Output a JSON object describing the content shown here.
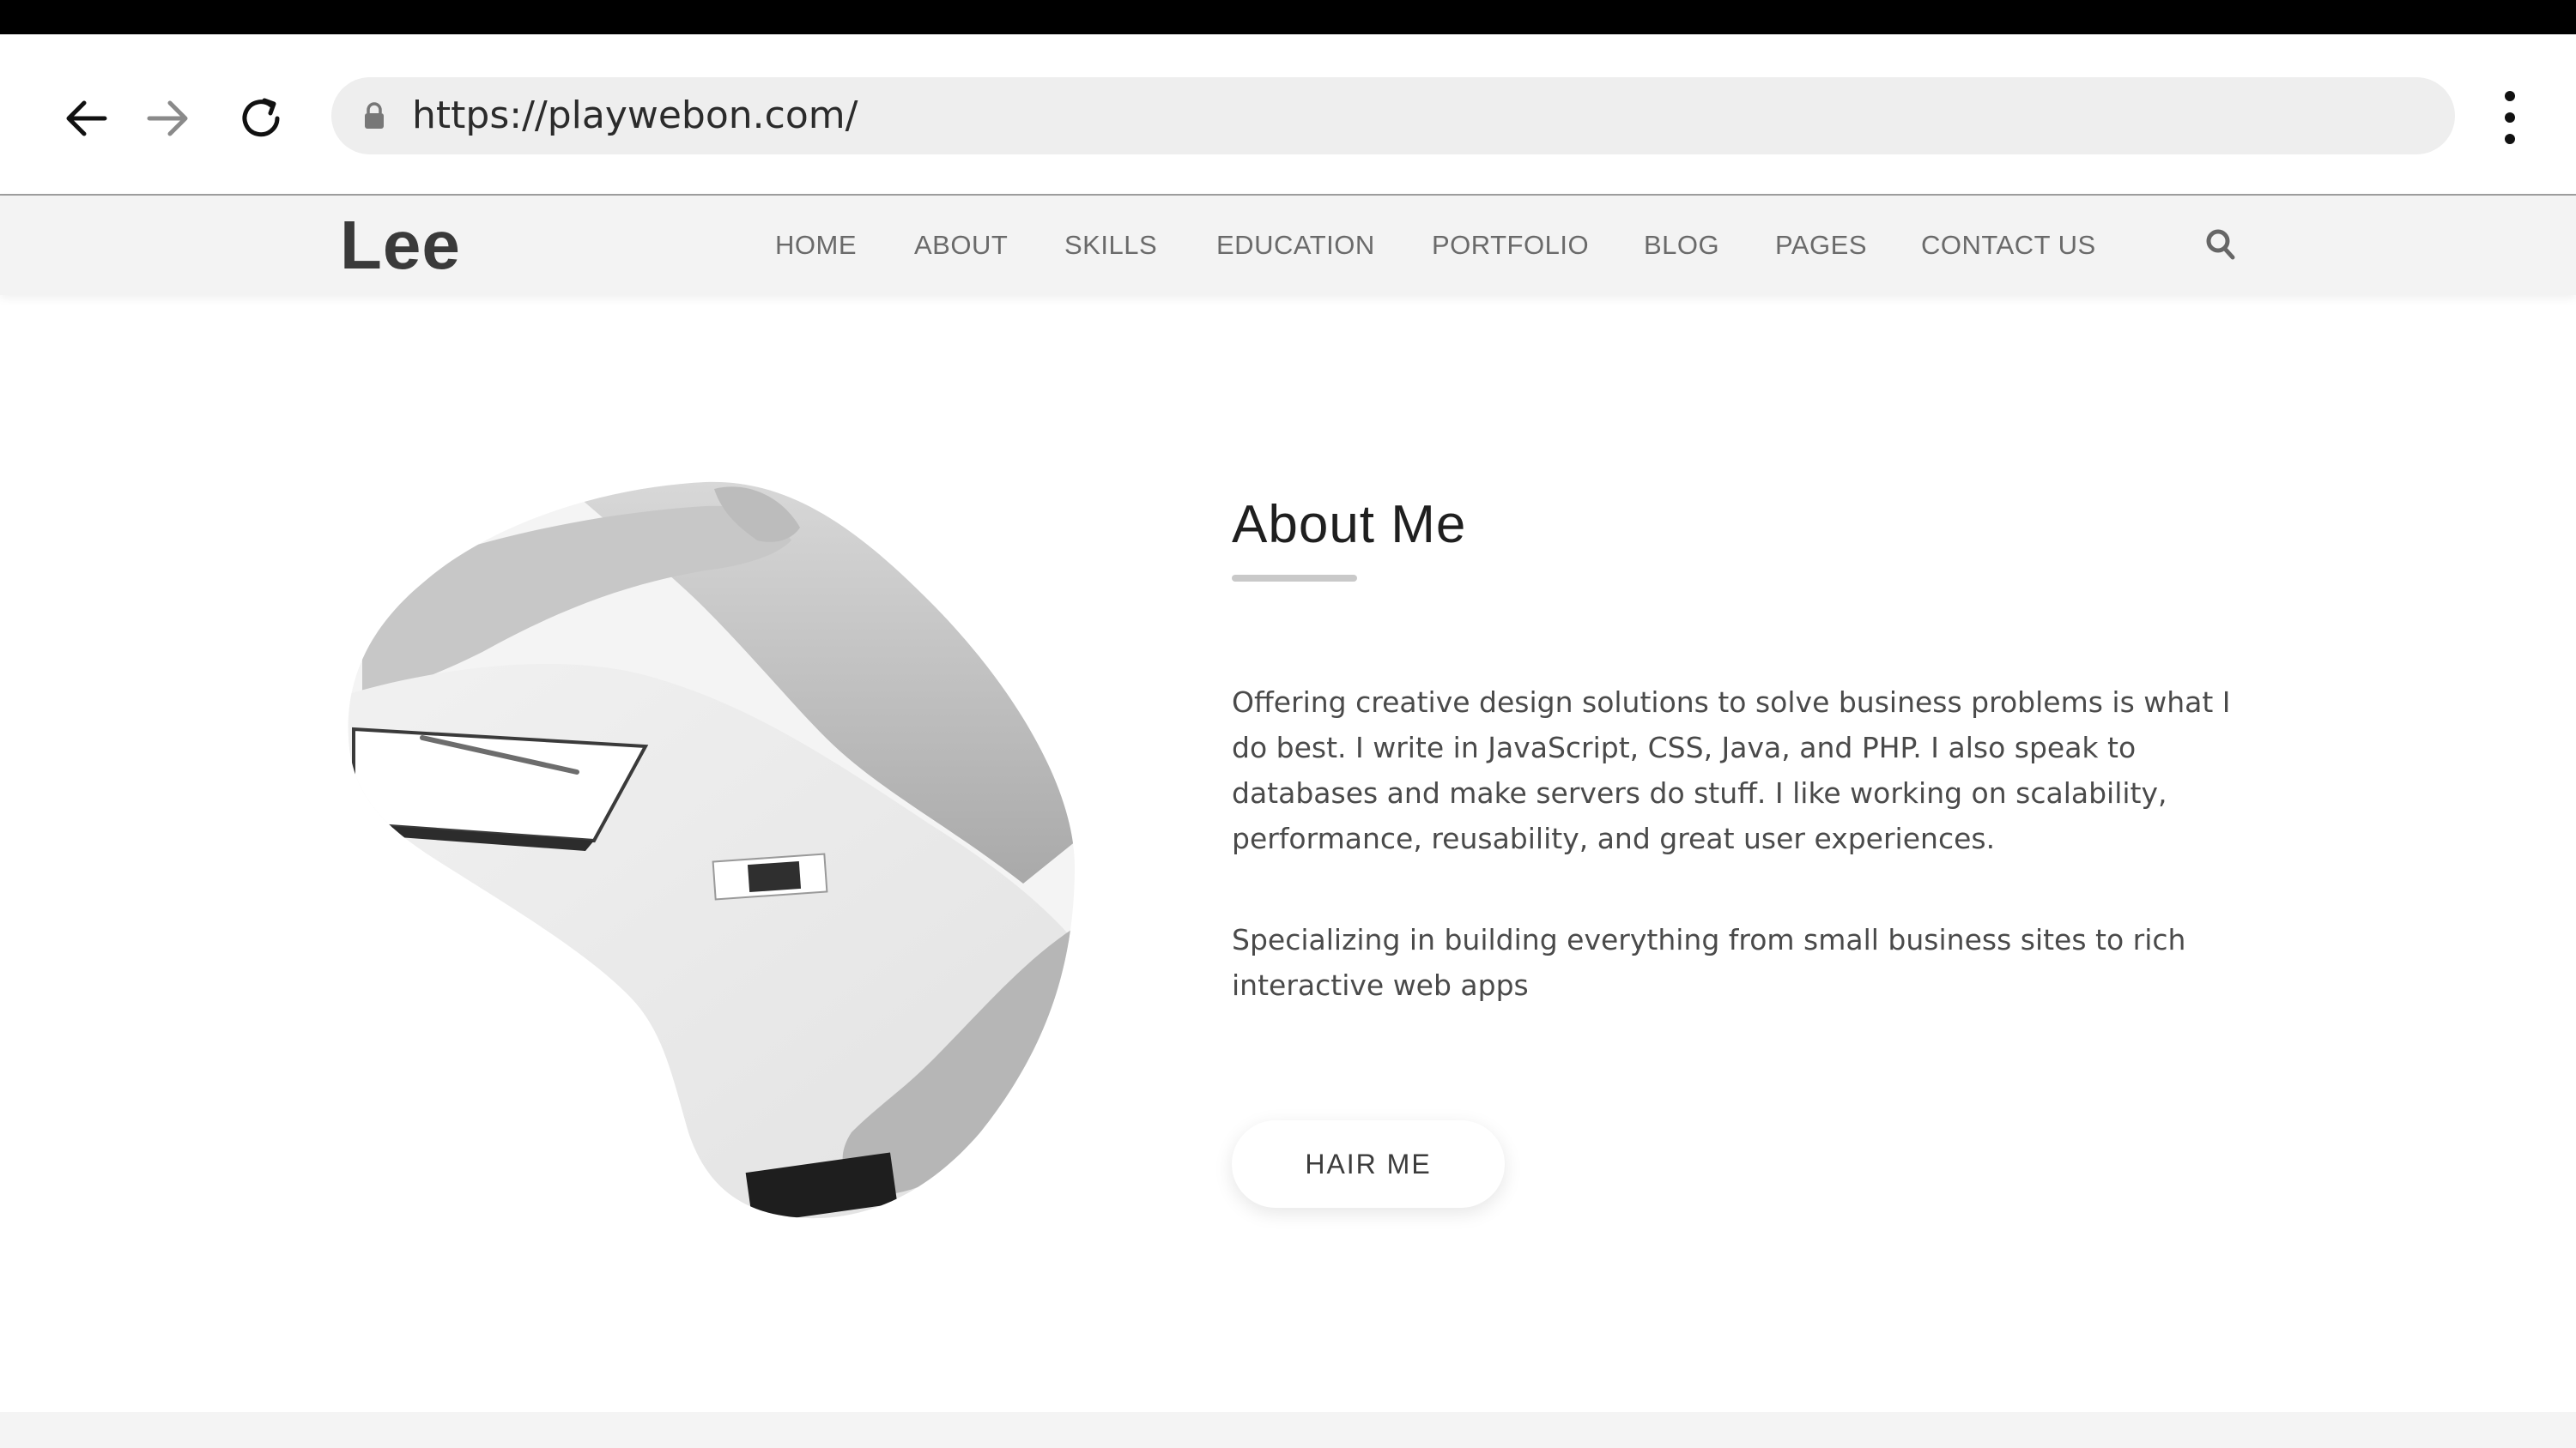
{
  "browser": {
    "url": "https://playwebon.com/",
    "back_icon": "arrow-left-icon",
    "forward_icon": "arrow-right-icon",
    "reload_icon": "reload-icon",
    "lock_icon": "lock-icon",
    "menu_icon": "more-vertical-icon"
  },
  "site": {
    "logo": "Lee",
    "nav": [
      {
        "label": "HOME"
      },
      {
        "label": "ABOUT"
      },
      {
        "label": "SKILLS"
      },
      {
        "label": "EDUCATION"
      },
      {
        "label": "PORTFOLIO"
      },
      {
        "label": "BLOG"
      },
      {
        "label": "PAGES"
      },
      {
        "label": "CONTACT US"
      }
    ],
    "search_icon": "search-icon"
  },
  "about": {
    "title": "About Me",
    "paragraphs": [
      "Offering creative design solutions to solve business problems is what I do best. I write in JavaScript, CSS, Java, and PHP. I also speak to databases and make servers do stuff. I like working on scalability, performance, reusability, and great user experiences.",
      "Specializing in building everything from small business sites to rich interactive web apps"
    ],
    "button_label": "HAIR ME"
  },
  "colors": {
    "header_bg": "#f3f3f3",
    "nav_text": "#6a6a6a",
    "url_bar": "#eeeeee"
  }
}
